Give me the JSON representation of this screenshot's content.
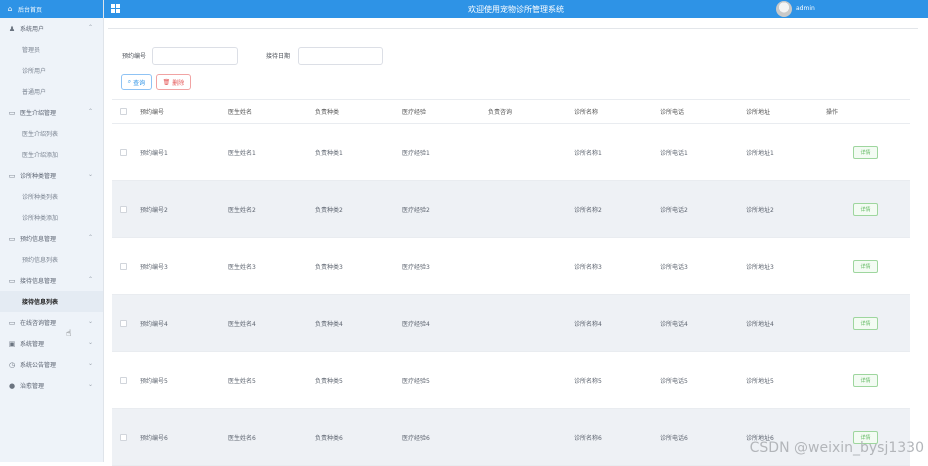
{
  "header": {
    "title": "欢迎使用宠物诊所管理系统",
    "username": "admin"
  },
  "sidebar": {
    "home": "后台首页",
    "items": [
      {
        "label": "系统用户",
        "icon": "user-icon",
        "arrow": "⌃",
        "level": 0
      },
      {
        "label": "管理员",
        "level": 1
      },
      {
        "label": "诊所用户",
        "level": 1
      },
      {
        "label": "普通用户",
        "level": 1
      },
      {
        "label": "医生介绍管理",
        "icon": "document-icon",
        "arrow": "⌃",
        "level": 0
      },
      {
        "label": "医生介绍列表",
        "level": 1
      },
      {
        "label": "医生介绍添加",
        "level": 1
      },
      {
        "label": "诊所种类管理",
        "icon": "document-icon",
        "arrow": "⌄",
        "level": 0
      },
      {
        "label": "诊所种类列表",
        "level": 1
      },
      {
        "label": "诊所种类添加",
        "level": 1
      },
      {
        "label": "预约信息管理",
        "icon": "document-icon",
        "arrow": "⌃",
        "level": 0
      },
      {
        "label": "预约信息列表",
        "level": 1
      },
      {
        "label": "接待信息管理",
        "icon": "document-icon",
        "arrow": "⌃",
        "level": 0
      },
      {
        "label": "接待信息列表",
        "level": 1,
        "active": true
      },
      {
        "label": "在线咨询管理",
        "icon": "document-icon",
        "arrow": "⌄",
        "level": 0
      },
      {
        "label": "系统管理",
        "icon": "calendar-icon",
        "arrow": "⌄",
        "level": 0
      },
      {
        "label": "系统公告管理",
        "icon": "clock-icon",
        "arrow": "⌄",
        "level": 0
      },
      {
        "label": "治愈管理",
        "icon": "pin-icon",
        "arrow": "⌄",
        "level": 0
      }
    ]
  },
  "search": {
    "field1_label": "预约编号",
    "field2_label": "接待日期",
    "search_button": "查询",
    "delete_button": "删除"
  },
  "table": {
    "columns": [
      "预约编号",
      "医生姓名",
      "负责种类",
      "医疗经验",
      "负责咨询",
      "诊所名称",
      "诊所电话",
      "诊所地址",
      "操作"
    ],
    "rows": [
      [
        "预约编号1",
        "医生姓名1",
        "负责种类1",
        "医疗经验1",
        "",
        "诊所名称1",
        "诊所电话1",
        "诊所地址1"
      ],
      [
        "预约编号2",
        "医生姓名2",
        "负责种类2",
        "医疗经验2",
        "",
        "诊所名称2",
        "诊所电话2",
        "诊所地址2"
      ],
      [
        "预约编号3",
        "医生姓名3",
        "负责种类3",
        "医疗经验3",
        "",
        "诊所名称3",
        "诊所电话3",
        "诊所地址3"
      ],
      [
        "预约编号4",
        "医生姓名4",
        "负责种类4",
        "医疗经验4",
        "",
        "诊所名称4",
        "诊所电话4",
        "诊所地址4"
      ],
      [
        "预约编号5",
        "医生姓名5",
        "负责种类5",
        "医疗经验5",
        "",
        "诊所名称5",
        "诊所电话5",
        "诊所地址5"
      ],
      [
        "预约编号6",
        "医生姓名6",
        "负责种类6",
        "医疗经验6",
        "",
        "诊所名称6",
        "诊所电话6",
        "诊所地址6"
      ]
    ],
    "detail_label": "详情"
  },
  "watermark": "CSDN @weixin_bysj1330",
  "colors": {
    "primary": "#2e93e6",
    "danger": "#e45656",
    "success": "#5fb85f"
  }
}
